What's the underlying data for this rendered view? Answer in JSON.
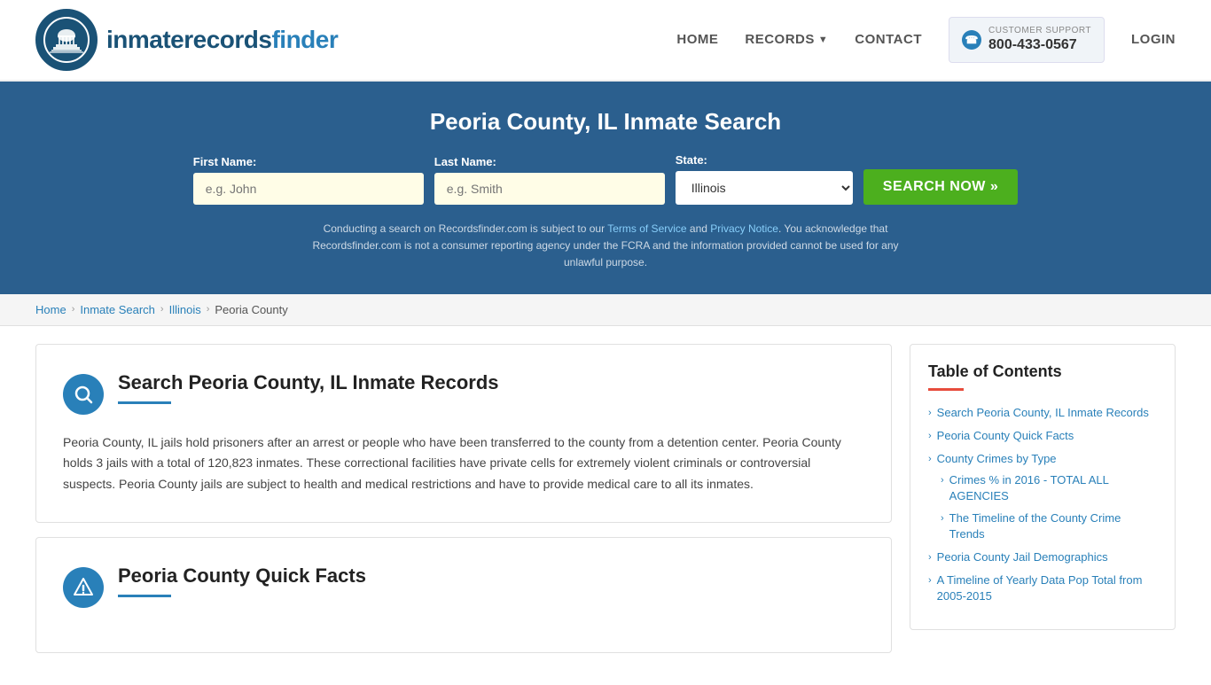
{
  "header": {
    "logo_text_main": "inmaterecords",
    "logo_text_bold": "finder",
    "nav": {
      "home": "HOME",
      "records": "RECORDS",
      "contact": "CONTACT",
      "support_label": "CUSTOMER SUPPORT",
      "support_number": "800-433-0567",
      "login": "LOGIN"
    }
  },
  "hero": {
    "title": "Peoria County, IL Inmate Search",
    "form": {
      "first_name_label": "First Name:",
      "first_name_placeholder": "e.g. John",
      "last_name_label": "Last Name:",
      "last_name_placeholder": "e.g. Smith",
      "state_label": "State:",
      "state_value": "Illinois",
      "search_btn": "SEARCH NOW »"
    },
    "disclaimer": "Conducting a search on Recordsfinder.com is subject to our Terms of Service and Privacy Notice. You acknowledge that Recordsfinder.com is not a consumer reporting agency under the FCRA and the information provided cannot be used for any unlawful purpose."
  },
  "breadcrumb": {
    "home": "Home",
    "inmate_search": "Inmate Search",
    "illinois": "Illinois",
    "current": "Peoria County"
  },
  "content": {
    "section1": {
      "title": "Search Peoria County, IL Inmate Records",
      "text": "Peoria County, IL jails hold prisoners after an arrest or people who have been transferred to the county from a detention center. Peoria County holds 3 jails with a total of 120,823 inmates. These correctional facilities have private cells for extremely violent criminals or controversial suspects. Peoria County jails are subject to health and medical restrictions and have to provide medical care to all its inmates."
    },
    "section2": {
      "title": "Peoria County Quick Facts"
    }
  },
  "toc": {
    "title": "Table of Contents",
    "items": [
      {
        "label": "Search Peoria County, IL Inmate Records",
        "sub": []
      },
      {
        "label": "Peoria County Quick Facts",
        "sub": []
      },
      {
        "label": "County Crimes by Type",
        "sub": [
          "Crimes % in 2016 - TOTAL ALL AGENCIES",
          "The Timeline of the County Crime Trends"
        ]
      },
      {
        "label": "Peoria County Jail Demographics",
        "sub": []
      },
      {
        "label": "A Timeline of Yearly Data Pop Total from 2005-2015",
        "sub": []
      }
    ]
  }
}
